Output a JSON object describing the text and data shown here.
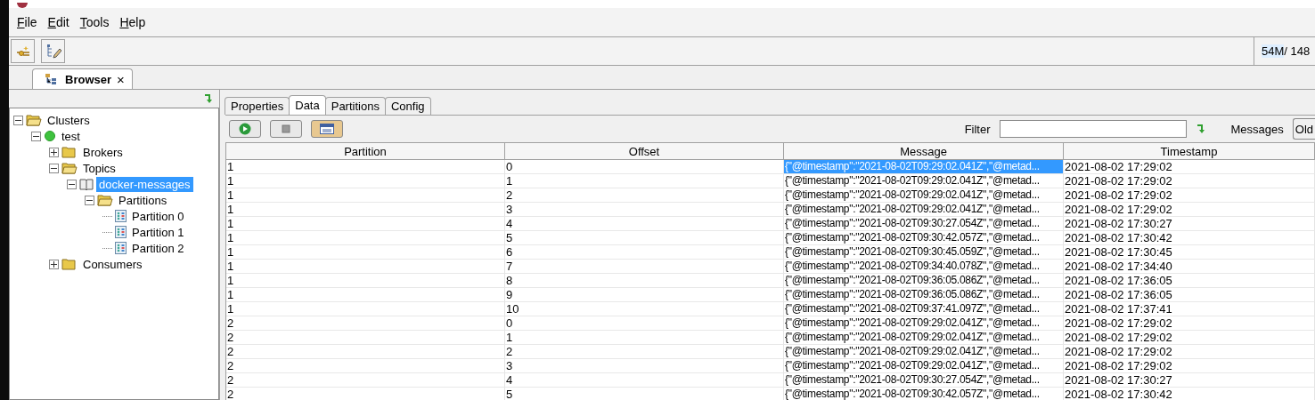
{
  "menu": [
    {
      "label": "File"
    },
    {
      "label": "Edit"
    },
    {
      "label": "Tools"
    },
    {
      "label": "Help"
    }
  ],
  "memory": {
    "used": "54M",
    "rest": " / 148"
  },
  "browser_tab": {
    "label": "Browser",
    "close": "×"
  },
  "tree": [
    {
      "label": "Clusters",
      "kind": "folder",
      "expanded": true,
      "selected": false,
      "children": [
        {
          "label": "test",
          "kind": "cluster",
          "expanded": true,
          "selected": false,
          "children": [
            {
              "label": "Brokers",
              "kind": "folder",
              "expanded": false,
              "selected": false
            },
            {
              "label": "Topics",
              "kind": "folder",
              "expanded": true,
              "selected": false,
              "children": [
                {
                  "label": "docker-messages",
                  "kind": "topic",
                  "expanded": true,
                  "selected": true,
                  "children": [
                    {
                      "label": "Partitions",
                      "kind": "folder",
                      "expanded": true,
                      "selected": false,
                      "children": [
                        {
                          "label": "Partition 0",
                          "kind": "partition",
                          "selected": false
                        },
                        {
                          "label": "Partition 1",
                          "kind": "partition",
                          "selected": false
                        },
                        {
                          "label": "Partition 2",
                          "kind": "partition",
                          "selected": false
                        }
                      ]
                    }
                  ]
                }
              ]
            },
            {
              "label": "Consumers",
              "kind": "folder",
              "expanded": false,
              "selected": false
            }
          ]
        }
      ]
    }
  ],
  "tabs": [
    {
      "label": "Properties",
      "selected": false
    },
    {
      "label": "Data",
      "selected": true
    },
    {
      "label": "Partitions",
      "selected": false
    },
    {
      "label": "Config",
      "selected": false
    }
  ],
  "filter": {
    "label": "Filter"
  },
  "messages": {
    "label": "Messages",
    "value": "Old"
  },
  "table": {
    "columns": [
      "Partition",
      "Offset",
      "Message",
      "Timestamp"
    ],
    "rows": [
      {
        "cells": [
          "1",
          "0",
          "{\"@timestamp\":\"2021-08-02T09:29:02.041Z\",\"@metad...",
          "2021-08-02 17:29:02"
        ],
        "selected": true
      },
      {
        "cells": [
          "1",
          "1",
          "{\"@timestamp\":\"2021-08-02T09:29:02.041Z\",\"@metad...",
          "2021-08-02 17:29:02"
        ],
        "selected": false
      },
      {
        "cells": [
          "1",
          "2",
          "{\"@timestamp\":\"2021-08-02T09:29:02.041Z\",\"@metad...",
          "2021-08-02 17:29:02"
        ],
        "selected": false
      },
      {
        "cells": [
          "1",
          "3",
          "{\"@timestamp\":\"2021-08-02T09:29:02.041Z\",\"@metad...",
          "2021-08-02 17:29:02"
        ],
        "selected": false
      },
      {
        "cells": [
          "1",
          "4",
          "{\"@timestamp\":\"2021-08-02T09:30:27.054Z\",\"@metad...",
          "2021-08-02 17:30:27"
        ],
        "selected": false
      },
      {
        "cells": [
          "1",
          "5",
          "{\"@timestamp\":\"2021-08-02T09:30:42.057Z\",\"@metad...",
          "2021-08-02 17:30:42"
        ],
        "selected": false
      },
      {
        "cells": [
          "1",
          "6",
          "{\"@timestamp\":\"2021-08-02T09:30:45.059Z\",\"@metad...",
          "2021-08-02 17:30:45"
        ],
        "selected": false
      },
      {
        "cells": [
          "1",
          "7",
          "{\"@timestamp\":\"2021-08-02T09:34:40.078Z\",\"@metad...",
          "2021-08-02 17:34:40"
        ],
        "selected": false
      },
      {
        "cells": [
          "1",
          "8",
          "{\"@timestamp\":\"2021-08-02T09:36:05.086Z\",\"@metad...",
          "2021-08-02 17:36:05"
        ],
        "selected": false
      },
      {
        "cells": [
          "1",
          "9",
          "{\"@timestamp\":\"2021-08-02T09:36:05.086Z\",\"@metad...",
          "2021-08-02 17:36:05"
        ],
        "selected": false
      },
      {
        "cells": [
          "1",
          "10",
          "{\"@timestamp\":\"2021-08-02T09:37:41.097Z\",\"@metad...",
          "2021-08-02 17:37:41"
        ],
        "selected": false
      },
      {
        "cells": [
          "2",
          "0",
          "{\"@timestamp\":\"2021-08-02T09:29:02.041Z\",\"@metad...",
          "2021-08-02 17:29:02"
        ],
        "selected": false
      },
      {
        "cells": [
          "2",
          "1",
          "{\"@timestamp\":\"2021-08-02T09:29:02.041Z\",\"@metad...",
          "2021-08-02 17:29:02"
        ],
        "selected": false
      },
      {
        "cells": [
          "2",
          "2",
          "{\"@timestamp\":\"2021-08-02T09:29:02.041Z\",\"@metad...",
          "2021-08-02 17:29:02"
        ],
        "selected": false
      },
      {
        "cells": [
          "2",
          "3",
          "{\"@timestamp\":\"2021-08-02T09:29:02.041Z\",\"@metad...",
          "2021-08-02 17:29:02"
        ],
        "selected": false
      },
      {
        "cells": [
          "2",
          "4",
          "{\"@timestamp\":\"2021-08-02T09:30:27.054Z\",\"@metad...",
          "2021-08-02 17:30:27"
        ],
        "selected": false
      },
      {
        "cells": [
          "2",
          "5",
          "{\"@timestamp\":\"2021-08-02T09:30:42.057Z\",\"@metad...",
          "2021-08-02 17:30:42"
        ],
        "selected": false
      }
    ]
  }
}
